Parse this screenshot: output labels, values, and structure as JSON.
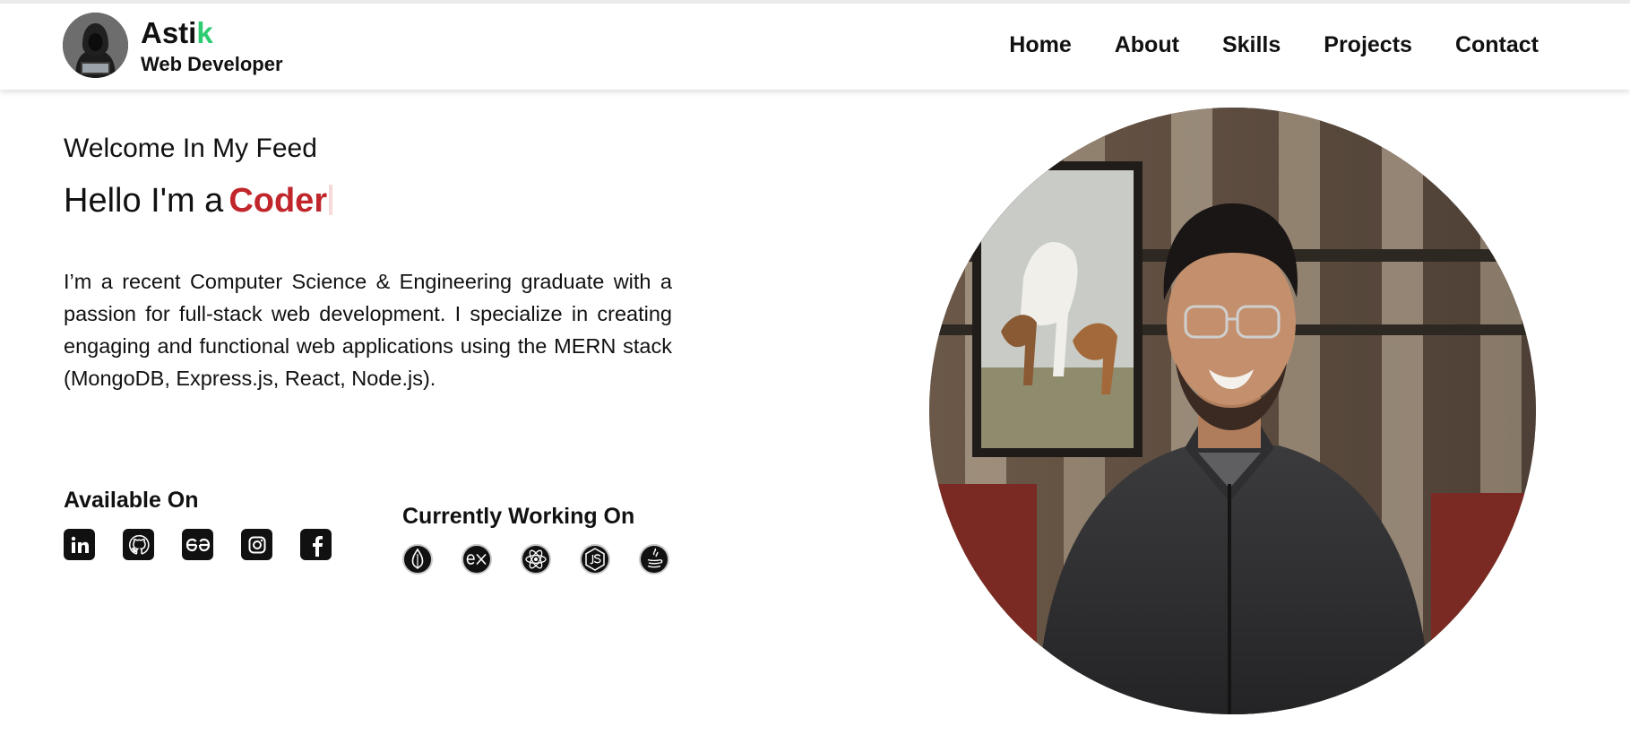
{
  "brand": {
    "name_main": "Asti",
    "name_accent": "k",
    "role": "Web Developer",
    "accent_color": "#2ecc71"
  },
  "nav": {
    "items": [
      {
        "label": "Home"
      },
      {
        "label": "About"
      },
      {
        "label": "Skills"
      },
      {
        "label": "Projects"
      },
      {
        "label": "Contact"
      }
    ]
  },
  "hero": {
    "welcome": "Welcome In My Feed",
    "hello_prefix": "Hello I'm a",
    "typed_word": "Coder",
    "typed_color": "#c0262b",
    "bio": "I’m a recent Computer Science & Engineering graduate with a passion for full-stack web development. I specialize in creating engaging and functional web applications using the MERN stack (MongoDB, Express.js, React, Node.js)."
  },
  "available": {
    "title": "Available On",
    "icons": [
      "linkedin-icon",
      "github-icon",
      "geeksforgeeks-icon",
      "instagram-icon",
      "facebook-icon"
    ]
  },
  "working": {
    "title": "Currently Working On",
    "icons": [
      "mongodb-icon",
      "express-icon",
      "react-icon",
      "nodejs-icon",
      "java-icon"
    ]
  }
}
